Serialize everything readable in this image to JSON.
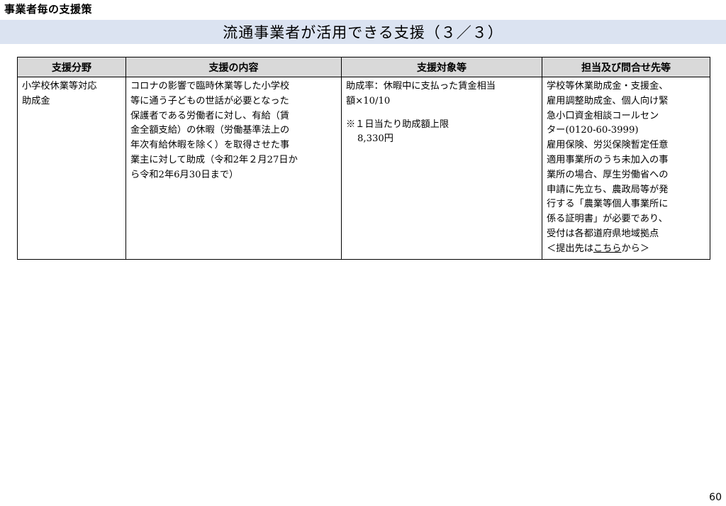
{
  "header": {
    "section_label": "事業者毎の支援策",
    "title": "流通事業者が活用できる支援（３／３）"
  },
  "table": {
    "columns": [
      "支援分野",
      "支援の内容",
      "支援対象等",
      "担当及び問合せ先等"
    ],
    "row": {
      "field_lines": [
        "小学校休業等対応",
        "助成金"
      ],
      "content_lines": [
        "コロナの影響で臨時休業等した小学校",
        "等に通う子どもの世話が必要となった",
        "保護者である労働者に対し、有給（賃",
        "金全額支給）の休暇（労働基準法上の",
        "年次有給休暇を除く）を取得させた事",
        "業主に対して助成（令和2年２月27日か",
        "ら令和2年6月30日まで）"
      ],
      "target_lines": [
        "助成率：休暇中に支払った賃金相当",
        "額×10/10"
      ],
      "target_note": "※１日当たり助成額上限",
      "target_amount": "8,330円",
      "contact_lines": [
        "学校等休業助成金・支援金、",
        "雇用調整助成金、個人向け緊",
        "急小口資金相談コールセン",
        "ター(0120-60-3999)",
        "雇用保険、労災保険暫定任意",
        "適用事業所のうち未加入の事",
        "業所の場合、厚生労働省への",
        "申請に先立ち、農政局等が発",
        "行する「農業等個人事業所に",
        "係る証明書」が必要であり、",
        "受付は各都道府県地域拠点"
      ],
      "contact_last_prefix": "＜提出先は",
      "contact_link": "こちら",
      "contact_last_suffix": "から＞"
    }
  },
  "footer": {
    "page_number": "60"
  }
}
